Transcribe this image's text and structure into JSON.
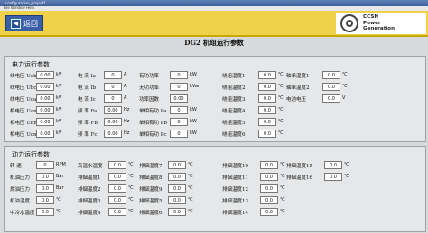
{
  "window": {
    "title": "configuration_project1",
    "menu": "File  Window  Help"
  },
  "header": {
    "back_label": "返回",
    "back_arrow": "◀",
    "logo_lines": [
      "CCSN",
      "Power",
      "Generation"
    ]
  },
  "page_title": "DG2  机组运行参数",
  "electric": {
    "title": "电力运行参数",
    "rows": [
      [
        {
          "label": "线电压 Uab",
          "value": "0.00",
          "unit": "kV"
        },
        {
          "label": "电  流  Ia",
          "value": "0",
          "unit": "A"
        },
        {
          "label": "有功功率",
          "value": "0",
          "unit": "kW"
        },
        {
          "label": "绕组温度1",
          "value": "0.0",
          "unit": "℃"
        },
        {
          "label": "轴承温度1",
          "value": "0.0",
          "unit": "℃"
        }
      ],
      [
        {
          "label": "线电压 Ubc",
          "value": "0.00",
          "unit": "kV"
        },
        {
          "label": "电  流  Ib",
          "value": "0",
          "unit": "A"
        },
        {
          "label": "无功功率",
          "value": "0",
          "unit": "kVar"
        },
        {
          "label": "绕组温度2",
          "value": "0.0",
          "unit": "℃"
        },
        {
          "label": "轴承温度2",
          "value": "0.0",
          "unit": "℃"
        }
      ],
      [
        {
          "label": "线电压 Uca",
          "value": "0.00",
          "unit": "kV"
        },
        {
          "label": "电  流  Ic",
          "value": "0",
          "unit": "A"
        },
        {
          "label": "功率因数",
          "value": "0.00",
          "unit": ""
        },
        {
          "label": "绕组温度3",
          "value": "0.0",
          "unit": "℃"
        },
        {
          "label": "电池电压",
          "value": "0.0",
          "unit": "V"
        }
      ],
      [
        {
          "label": "相电压 Uan",
          "value": "0.00",
          "unit": "kV"
        },
        {
          "label": "频  率  Fa",
          "value": "0.00",
          "unit": "Hz"
        },
        {
          "label": "单相有功 Pa",
          "value": "0",
          "unit": "kW"
        },
        {
          "label": "绕组温度4",
          "value": "0.0",
          "unit": "℃"
        }
      ],
      [
        {
          "label": "相电压 Ubn",
          "value": "0.00",
          "unit": "kV"
        },
        {
          "label": "频  率  Fb",
          "value": "0.00",
          "unit": "Hz"
        },
        {
          "label": "单相有功 Pb",
          "value": "0",
          "unit": "kW"
        },
        {
          "label": "绕组温度5",
          "value": "0.0",
          "unit": "℃"
        }
      ],
      [
        {
          "label": "相电压 Ucn",
          "value": "0.00",
          "unit": "kV"
        },
        {
          "label": "频  率  Fc",
          "value": "0.00",
          "unit": "Hz"
        },
        {
          "label": "单相有功 Pc",
          "value": "0",
          "unit": "kW"
        },
        {
          "label": "绕组温度6",
          "value": "0.0",
          "unit": "℃"
        }
      ]
    ]
  },
  "power": {
    "title": "动力运行参数",
    "rows": [
      [
        {
          "label": "转  速",
          "value": "0",
          "unit": "RPM"
        },
        {
          "label": "高温水温度",
          "value": "0.0",
          "unit": "℃"
        },
        {
          "label": "排烟温度7",
          "value": "0.0",
          "unit": "℃"
        },
        {
          "label": "排烟温度10",
          "value": "0.0",
          "unit": "℃"
        },
        {
          "label": "排烟温度15",
          "value": "0.0",
          "unit": "℃"
        }
      ],
      [
        {
          "label": "机油压力",
          "value": "0.0",
          "unit": "Bar"
        },
        {
          "label": "排烟温度1",
          "value": "0.0",
          "unit": "℃"
        },
        {
          "label": "排烟温度8",
          "value": "0.0",
          "unit": "℃"
        },
        {
          "label": "排烟温度11",
          "value": "0.0",
          "unit": "℃"
        },
        {
          "label": "排烟温度16",
          "value": "0.0",
          "unit": "℃"
        }
      ],
      [
        {
          "label": "燃油压力",
          "value": "0.0",
          "unit": "Bar"
        },
        {
          "label": "排烟温度2",
          "value": "0.0",
          "unit": "℃"
        },
        {
          "label": "排烟温度9",
          "value": "0.0",
          "unit": "℃"
        },
        {
          "label": "排烟温度12",
          "value": "0.0",
          "unit": "℃"
        }
      ],
      [
        {
          "label": "机油温度",
          "value": "0.0",
          "unit": "℃"
        },
        {
          "label": "排烟温度3",
          "value": "0.0",
          "unit": "℃"
        },
        {
          "label": "排烟温度5",
          "value": "0.0",
          "unit": "℃"
        },
        {
          "label": "排烟温度13",
          "value": "0.0",
          "unit": "℃"
        }
      ],
      [
        {
          "label": "中冷水温度",
          "value": "0.0",
          "unit": "℃"
        },
        {
          "label": "排烟温度4",
          "value": "0.0",
          "unit": "℃"
        },
        {
          "label": "排烟温度6",
          "value": "0.0",
          "unit": "℃"
        },
        {
          "label": "排烟温度14",
          "value": "0.0",
          "unit": "℃"
        }
      ]
    ]
  }
}
